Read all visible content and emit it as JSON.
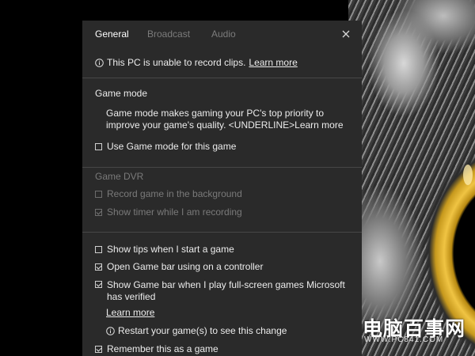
{
  "wallpaper": {
    "watermark_text": "电脑百事网",
    "watermark_url": "WWW.PC841.COM"
  },
  "tabs": [
    {
      "label": "General",
      "active": true
    },
    {
      "label": "Broadcast",
      "active": false
    },
    {
      "label": "Audio",
      "active": false
    }
  ],
  "notice": {
    "text": "This PC is unable to record clips.",
    "link": "Learn more"
  },
  "game_mode": {
    "title": "Game mode",
    "description": "Game mode makes gaming your PC's top priority to improve your game's quality. <UNDERLINE>Learn more",
    "checkbox_label": "Use Game mode for this game",
    "checked": false
  },
  "game_dvr": {
    "title": "Game DVR",
    "record_background_label": "Record game in the background",
    "record_background_checked": false,
    "show_timer_label": "Show timer while I am recording",
    "show_timer_checked": true
  },
  "options": {
    "show_tips_label": "Show tips when I start a game",
    "show_tips_checked": false,
    "open_gamebar_label": "Open Game bar using  on a controller",
    "open_gamebar_checked": true,
    "show_fullscreen_label": "Show Game bar when I play full-screen games Microsoft has verified",
    "show_fullscreen_checked": true,
    "learn_more": "Learn more",
    "restart_notice": "Restart your game(s) to see this change",
    "remember_label": "Remember this as a game",
    "remember_checked": true
  },
  "colors": {
    "panel_bg": "#2a2a2a",
    "text": "#ececec",
    "dim_text": "#7a7a7a",
    "divider": "#474747"
  }
}
